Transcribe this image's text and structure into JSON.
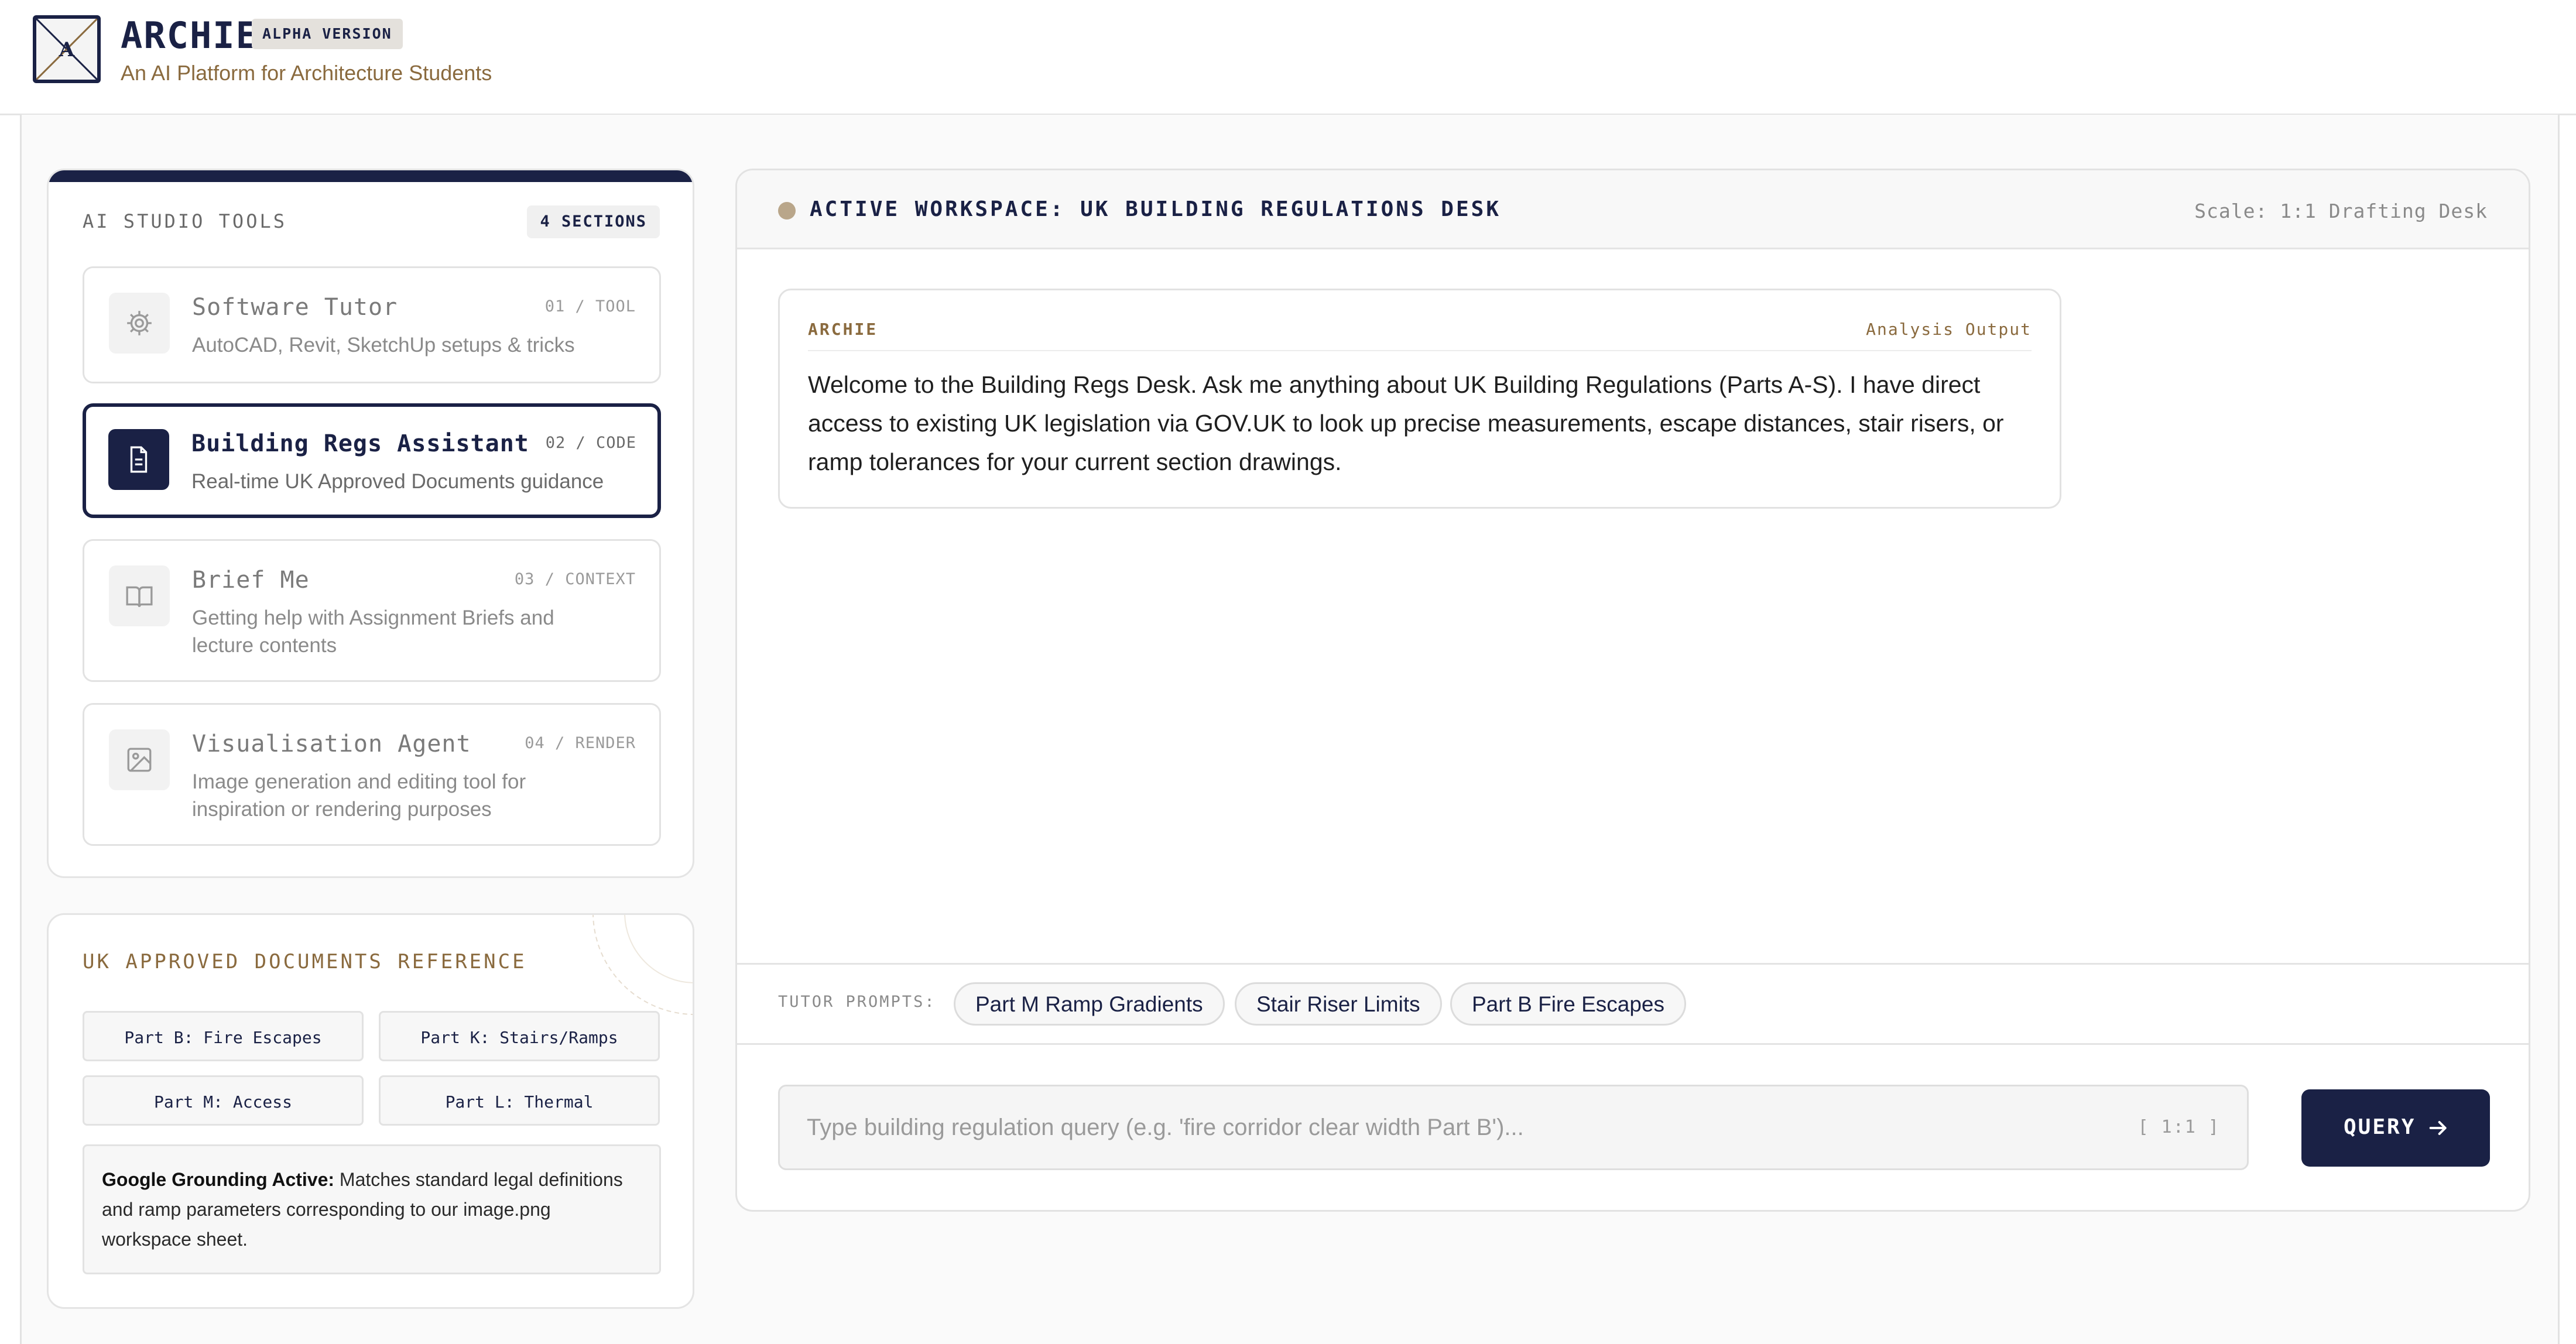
{
  "header": {
    "app_name": "ARCHIE",
    "badge": "ALPHA VERSION",
    "tagline": "An AI Platform for Architecture Students",
    "logo_icon": "archie-logo"
  },
  "tools_panel": {
    "title": "AI STUDIO TOOLS",
    "sections_badge": "4 SECTIONS",
    "tools": [
      {
        "name": "Software Tutor",
        "code": "01 / TOOL",
        "description": "AutoCAD, Revit, SketchUp setups & tricks",
        "icon": "gear-icon",
        "active": false
      },
      {
        "name": "Building Regs Assistant",
        "code": "02 / CODE",
        "description": "Real-time UK Approved Documents guidance",
        "icon": "document-icon",
        "active": true
      },
      {
        "name": "Brief Me",
        "code": "03 / CONTEXT",
        "description": "Getting help with Assignment Briefs and lecture contents",
        "icon": "book-icon",
        "active": false
      },
      {
        "name": "Visualisation Agent",
        "code": "04 / RENDER",
        "description": "Image generation and editing tool for inspiration or rendering purposes",
        "icon": "image-icon",
        "active": false
      }
    ]
  },
  "reference_panel": {
    "title": "UK APPROVED DOCUMENTS REFERENCE",
    "buttons": [
      "Part B: Fire Escapes",
      "Part K: Stairs/Ramps",
      "Part M: Access",
      "Part L: Thermal"
    ],
    "note_strong": "Google Grounding Active:",
    "note_text": " Matches standard legal definitions and ramp parameters corresponding to our image.png workspace sheet."
  },
  "workspace": {
    "title": "ACTIVE WORKSPACE: UK BUILDING REGULATIONS DESK",
    "scale": "Scale: 1:1 Drafting Desk",
    "status_color": "#b9a68a"
  },
  "message": {
    "sender": "ARCHIE",
    "label": "Analysis Output",
    "text": "Welcome to the Building Regs Desk. Ask me anything about UK Building Regulations (Parts A-S). I have direct access to existing UK legislation via GOV.UK to look up precise measurements, escape distances, stair risers, or ramp tolerances for your current section drawings."
  },
  "prompts": {
    "label": "TUTOR PROMPTS:",
    "chips": [
      "Part M Ramp Gradients",
      "Stair Riser Limits",
      "Part B Fire Escapes"
    ]
  },
  "query": {
    "placeholder": "Type building regulation query (e.g. 'fire corridor clear width Part B')...",
    "scale_tag": "[ 1:1 ]",
    "button_label": "QUERY"
  },
  "colors": {
    "navy": "#1a2145",
    "gold": "#8a6a3e"
  }
}
